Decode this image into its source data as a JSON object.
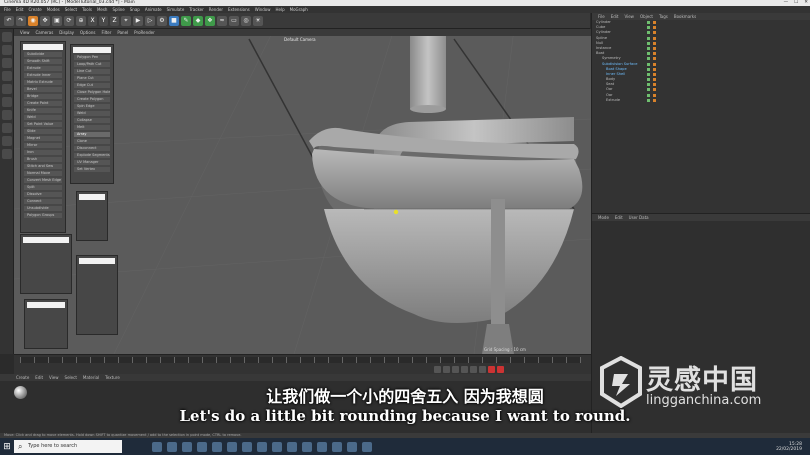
{
  "window": {
    "title": "Cinema 4D R20.057 (RC) - [ModelTutorial_03.c4d *] - Main",
    "controls": [
      "—",
      "☐",
      "✕"
    ]
  },
  "menubar": {
    "items": [
      "File",
      "Edit",
      "Create",
      "Modes",
      "Select",
      "Tools",
      "Mesh",
      "Spline",
      "Snap",
      "Animate",
      "Simulate",
      "Tracker",
      "Render",
      "Extensions",
      "Window",
      "Help",
      "MoGraph"
    ]
  },
  "toolbar": {
    "x_label": "X",
    "y_label": "Y",
    "z_label": "Z"
  },
  "viewport": {
    "menu": [
      "View",
      "Cameras",
      "Display",
      "Options",
      "Filter",
      "Panel",
      "ProRender"
    ],
    "camera_label": "Default Camera",
    "grid_spacing": "Grid Spacing : 10 cm"
  },
  "popups": {
    "p1_rows": [
      "Subdivide",
      "Smooth Shift",
      "Extrude",
      "Extrude Inner",
      "Matrix Extrude",
      "Bevel",
      "Bridge",
      "Create Point",
      "Knife",
      "Weld",
      "Set Point Value",
      "Slide",
      "Magnet",
      "Mirror",
      "Iron",
      "Brush",
      "Stitch and Sew",
      "Normal Move",
      "Convert Mesh Edge",
      "Split",
      "Dissolve",
      "Connect",
      "Unsubdivide",
      "Polygon Groups"
    ],
    "p2_rows": [
      "Polygon Pen",
      "Loop/Path Cut",
      "Line Cut",
      "Plane Cut",
      "Edge Cut",
      "Close Polygon Hole",
      "Create Polygon",
      "Spin Edge",
      "Weld",
      "Collapse",
      "Melt",
      "Array",
      "Clone",
      "Disconnect",
      "Explode Segments",
      "UV Manager",
      "Set Vertex"
    ],
    "p2_highlight": "Array"
  },
  "objects": {
    "menu": [
      "File",
      "Edit",
      "View",
      "Object",
      "Tags",
      "Bookmarks"
    ],
    "items": [
      "Cylinder",
      "Cube",
      "Cylinder",
      "Spline",
      "Null",
      "Instance",
      "Boat",
      "Symmetry",
      "Subdivision Surface",
      "Boat Shape",
      "Inner Shell",
      "Body",
      "Seat",
      "Oar",
      "Oar",
      "Extrude"
    ],
    "highlight": [
      "Subdivision Surface",
      "Boat Shape",
      "Inner Shell"
    ]
  },
  "attributes": {
    "menu": [
      "Mode",
      "Edit",
      "User Data"
    ]
  },
  "materials": {
    "menu": [
      "Create",
      "Edit",
      "View",
      "Select",
      "Material",
      "Texture"
    ]
  },
  "status_text": "Move: Click and drag to move elements. Hold down SHIFT to quantize movement / add to the selection in point mode, CTRL to remove.",
  "taskbar": {
    "search_placeholder": "Type here to search",
    "time": "15:28",
    "date": "22/02/2019"
  },
  "subtitles": {
    "cn": "让我们做一个小的四舍五入 因为我想圆",
    "en": "Let's do a little bit rounding because I want to round."
  },
  "watermark": {
    "cn": "灵感中国",
    "url": "lingganchina.com"
  }
}
